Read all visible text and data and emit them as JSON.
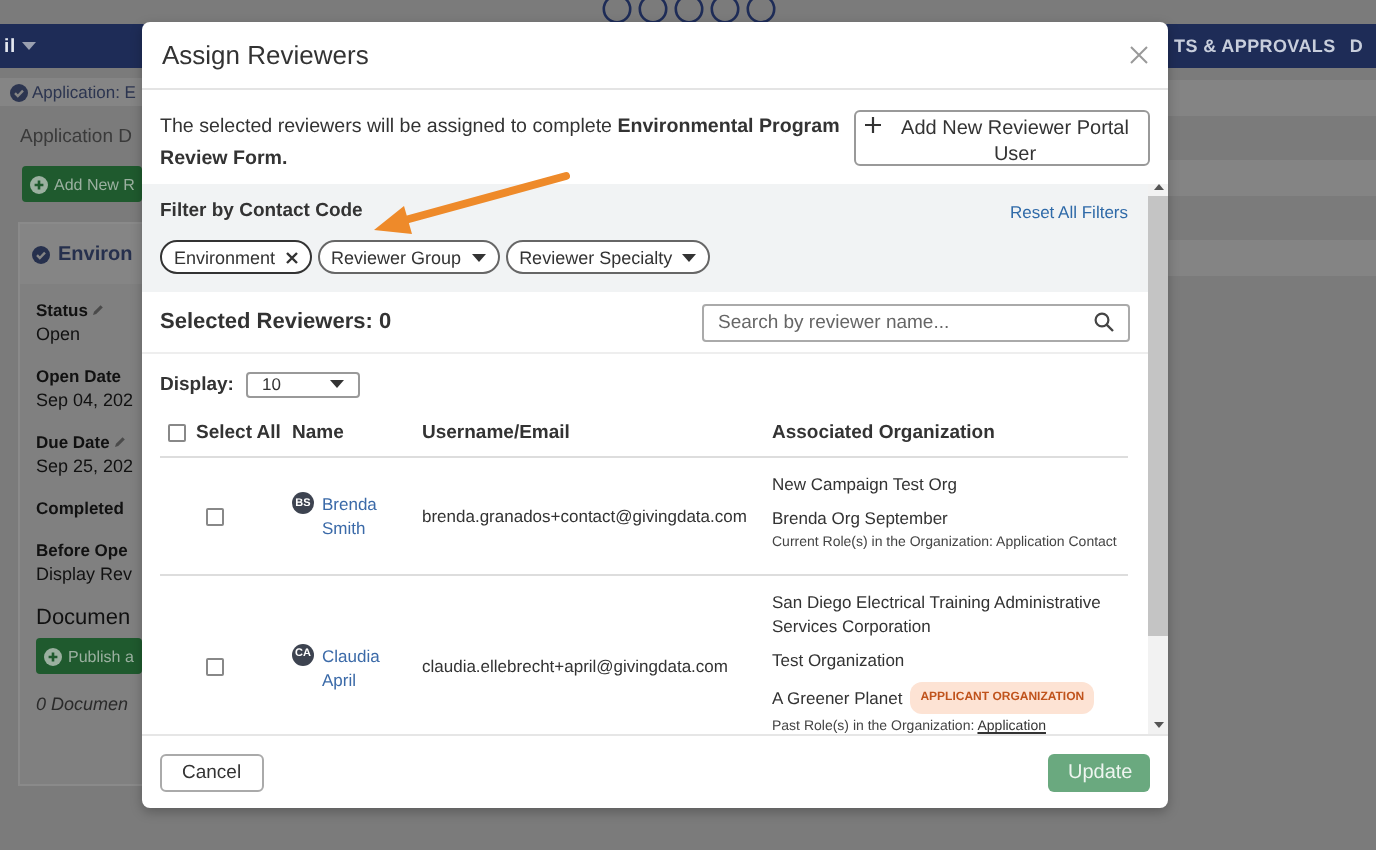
{
  "background": {
    "nav_left": "il",
    "nav_right": [
      "TS & APPROVALS",
      "D"
    ],
    "breadcrumb": "Application: E",
    "section_title": "Application D",
    "add_button": "Add New R",
    "panel_title": "Environ",
    "fields": [
      {
        "label": "Status",
        "value": "Open",
        "editable": true
      },
      {
        "label": "Open Date",
        "value": "Sep 04, 202",
        "editable": false
      },
      {
        "label": "Due Date",
        "value": "Sep 25, 202",
        "editable": true
      },
      {
        "label": "Completed",
        "editable": false
      },
      {
        "label": "Before Ope",
        "value": "Display Rev",
        "editable": false
      }
    ],
    "documents_title": "Documen",
    "publish_button": "Publish a",
    "documents_count": "0 Documen"
  },
  "modal": {
    "title": "Assign Reviewers",
    "intro": "The selected reviewers will be assigned to complete **Environmental Program Review Form.**",
    "add_button": "Add New Reviewer Portal User",
    "filter": {
      "title": "Filter by Contact Code",
      "reset": "Reset All Filters",
      "chips": [
        {
          "label": "Environment",
          "kind": "applied"
        },
        {
          "label": "Reviewer Group",
          "kind": "dropdown"
        },
        {
          "label": "Reviewer Specialty",
          "kind": "dropdown"
        }
      ]
    },
    "selected_count": "Selected Reviewers: 0",
    "search": {
      "placeholder": "Search by reviewer name..."
    },
    "display": {
      "label": "Display:",
      "value": "10"
    },
    "table": {
      "select_all": {
        "label": "Select All",
        "checked": false
      },
      "columns": [
        "Name",
        "Username/Email",
        "Associated Organization"
      ],
      "rows": [
        {
          "checked": false,
          "initials": "BS",
          "name": "Brenda Smith",
          "email": "brenda.granados+contact@givingdata.com",
          "orgs": [
            {
              "name": "New Campaign Test Org"
            },
            {
              "name": "Brenda Org September",
              "role": "Current Role(s) in the Organization: Application Contact"
            }
          ]
        },
        {
          "checked": false,
          "initials": "CA",
          "name": "Claudia April",
          "email": "claudia.ellebrecht+april@givingdata.com",
          "orgs": [
            {
              "name": "San Diego Electrical Training Administrative Services Corporation"
            },
            {
              "name": "Test Organization"
            },
            {
              "name": "A Greener Planet",
              "badge": "APPLICANT ORGANIZATION",
              "role": "Past Role(s) in the Organization:",
              "role_link": "Application"
            }
          ]
        }
      ]
    },
    "footer": {
      "cancel": "Cancel",
      "update": {
        "label": "Update",
        "disabled": true
      }
    }
  }
}
